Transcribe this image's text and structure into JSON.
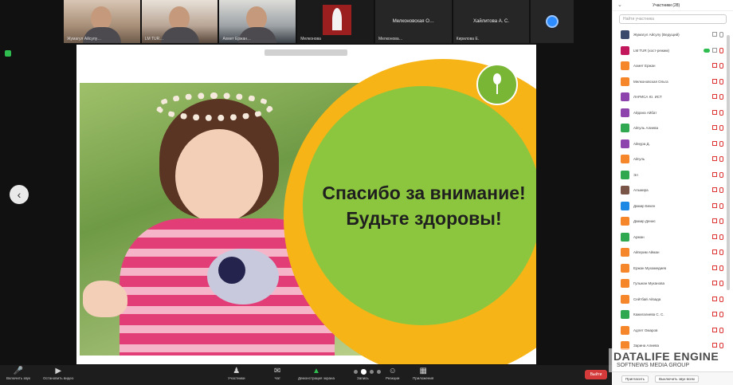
{
  "participants_strip": [
    {
      "name": "Жумагул Айсулу…"
    },
    {
      "name": "LM TUR…"
    },
    {
      "name": "Ахмет Ержан…"
    },
    {
      "name": "Мелконова"
    },
    {
      "name": "Мелконова…",
      "tile_label": "Мелконовская О…"
    },
    {
      "name": "Кирилова Е.",
      "tile_label": "Хайлитова А. С."
    }
  ],
  "slide": {
    "title_line1": "Спасибо за внимание!",
    "title_line2": "Будьте здоровы!"
  },
  "toolbar": [
    {
      "label": "Включить звук",
      "icon": "mic-icon"
    },
    {
      "label": "Остановить видео",
      "icon": "video-icon"
    },
    {
      "label": "Участники",
      "icon": "participants-icon"
    },
    {
      "label": "Чат",
      "icon": "chat-icon"
    },
    {
      "label": "Демонстрация экрана",
      "icon": "share-icon"
    },
    {
      "label": "Запись",
      "icon": "record-icon"
    },
    {
      "label": "Реакции",
      "icon": "reaction-icon"
    },
    {
      "label": "Приложения",
      "icon": "apps-icon"
    }
  ],
  "end_label": "Выйти",
  "panel": {
    "title": "Участники (28)",
    "search_placeholder": "Найти участника",
    "participants": [
      {
        "name": "Жумагул Айсулу (Ведущий)",
        "color": "#3b4a6b"
      },
      {
        "name": "LM TUR (хост-режим)",
        "color": "#c2185b"
      },
      {
        "name": "Ахмет Ержан",
        "color": "#f5862a"
      },
      {
        "name": "Мелконовская Ольга",
        "color": "#f5862a"
      },
      {
        "name": "ЛАРИСА Ю. ИСТ",
        "color": "#8e44ad"
      },
      {
        "name": "Айдана Айбат",
        "color": "#8e44ad"
      },
      {
        "name": "Айгуль Алиева",
        "color": "#2fa84f"
      },
      {
        "name": "Айнура Д.",
        "color": "#8e44ad"
      },
      {
        "name": "Айгуль",
        "color": "#f5862a"
      },
      {
        "name": "Эл",
        "color": "#2fa84f"
      },
      {
        "name": "Альмира",
        "color": "#795548"
      },
      {
        "name": "Дамир Бекен",
        "color": "#1e88e5"
      },
      {
        "name": "Дамир Денис",
        "color": "#f5862a"
      },
      {
        "name": "Арман",
        "color": "#2fa84f"
      },
      {
        "name": "Айгерим Айман",
        "color": "#f5862a"
      },
      {
        "name": "Ержан Мухамедиев",
        "color": "#f5862a"
      },
      {
        "name": "Гульжан Муканова",
        "color": "#f5862a"
      },
      {
        "name": "Сейтбай Айзада",
        "color": "#f5862a"
      },
      {
        "name": "Кажигалиева С. С.",
        "color": "#2fa84f"
      },
      {
        "name": "Адлет Омаров",
        "color": "#f5862a"
      },
      {
        "name": "Зарина Алиева",
        "color": "#f5862a"
      }
    ],
    "footer_invite": "Пригласить",
    "footer_mute": "Выключить звук всем"
  },
  "watermark": {
    "line1": "DATALIFE ENGINE",
    "line2": "SOFTNEWS MEDIA GROUP"
  }
}
